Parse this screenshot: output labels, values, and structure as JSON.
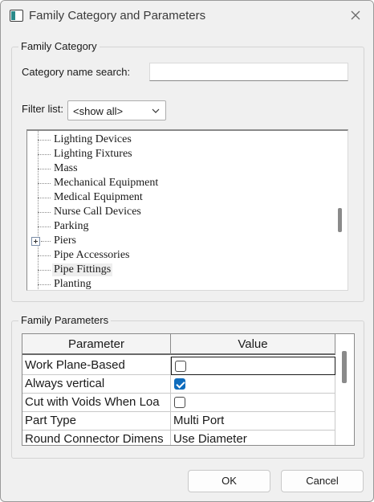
{
  "window": {
    "title": "Family Category and Parameters"
  },
  "category_group": {
    "legend": "Family Category",
    "search_label": "Category name search:",
    "search_value": "",
    "filter_label": "Filter list:",
    "filter_value": "<show all>",
    "items": [
      {
        "label": "Lighting Devices",
        "expandable": false,
        "selected": false
      },
      {
        "label": "Lighting Fixtures",
        "expandable": false,
        "selected": false
      },
      {
        "label": "Mass",
        "expandable": false,
        "selected": false
      },
      {
        "label": "Mechanical Equipment",
        "expandable": false,
        "selected": false
      },
      {
        "label": "Medical Equipment",
        "expandable": false,
        "selected": false
      },
      {
        "label": "Nurse Call Devices",
        "expandable": false,
        "selected": false
      },
      {
        "label": "Parking",
        "expandable": false,
        "selected": false
      },
      {
        "label": "Piers",
        "expandable": true,
        "selected": false
      },
      {
        "label": "Pipe Accessories",
        "expandable": false,
        "selected": false
      },
      {
        "label": "Pipe Fittings",
        "expandable": false,
        "selected": true
      },
      {
        "label": "Planting",
        "expandable": false,
        "selected": false
      }
    ]
  },
  "params_group": {
    "legend": "Family Parameters",
    "columns": {
      "parameter": "Parameter",
      "value": "Value"
    },
    "rows": [
      {
        "parameter": "Work Plane-Based",
        "type": "checkbox",
        "checked": false,
        "value": ""
      },
      {
        "parameter": "Always vertical",
        "type": "checkbox",
        "checked": true,
        "value": ""
      },
      {
        "parameter": "Cut with Voids When Loa",
        "type": "checkbox",
        "checked": false,
        "value": ""
      },
      {
        "parameter": "Part Type",
        "type": "text",
        "checked": false,
        "value": "Multi Port"
      },
      {
        "parameter": "Round Connector Dimens",
        "type": "text",
        "checked": false,
        "value": "Use Diameter"
      }
    ]
  },
  "buttons": {
    "ok": "OK",
    "cancel": "Cancel"
  },
  "colors": {
    "accent": "#0f6cbd",
    "selection": "#eeeeee"
  }
}
